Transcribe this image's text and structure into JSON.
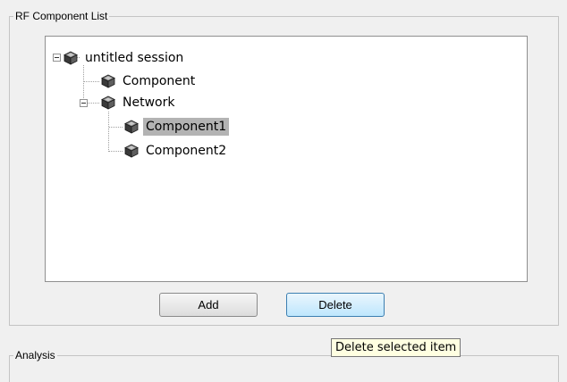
{
  "rf_component_list": {
    "title": "RF Component List",
    "tree": {
      "root": {
        "label": "untitled session",
        "icon": "cube-icon",
        "expanded": true
      },
      "component": {
        "label": "Component",
        "icon": "cube-icon"
      },
      "network": {
        "label": "Network",
        "icon": "cube-icon",
        "expanded": true
      },
      "component1": {
        "label": "Component1",
        "icon": "cube-icon",
        "selected": true
      },
      "component2": {
        "label": "Component2",
        "icon": "cube-icon"
      }
    },
    "buttons": {
      "add_label": "Add",
      "delete_label": "Delete"
    }
  },
  "analysis": {
    "title": "Analysis"
  },
  "tooltip": {
    "text": "Delete selected item"
  },
  "colors": {
    "selection": "#b3b3b3",
    "tooltip_bg": "#ffffe1",
    "focus_button": "#bee6fd"
  }
}
